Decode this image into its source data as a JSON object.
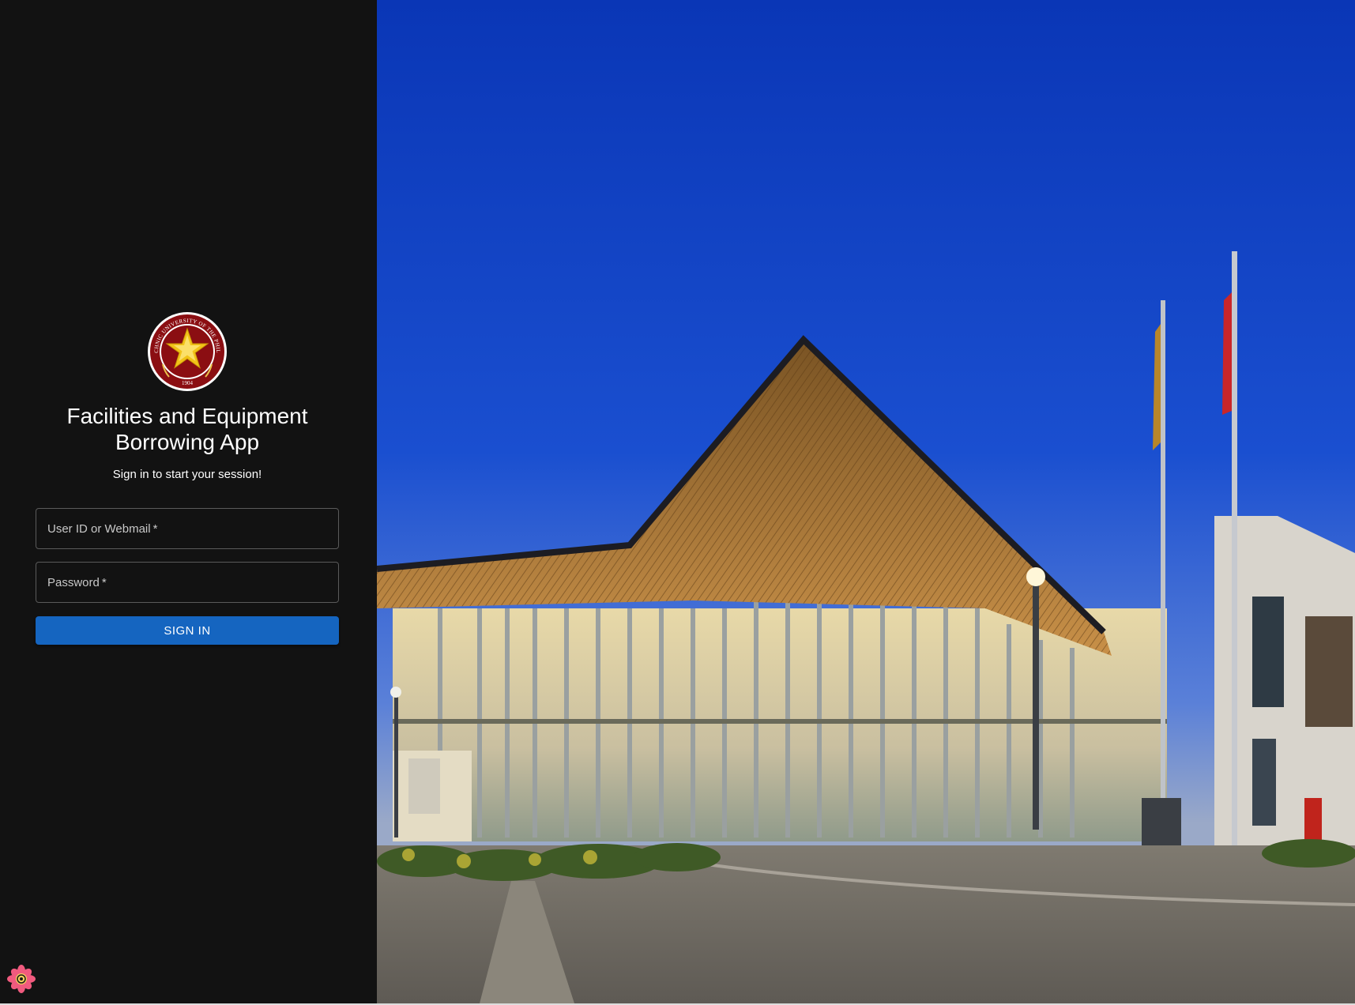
{
  "app": {
    "title": "Facilities and Equipment Borrowing App",
    "subtitle": "Sign in to start your session!"
  },
  "logo": {
    "name": "university-seal-logo",
    "seal_text": "POLYTECHNIC UNIVERSITY OF THE PHILIPPINES",
    "year": "1904"
  },
  "form": {
    "userid_label": "User ID or Webmail",
    "password_label": "Password",
    "required_mark": "*",
    "signin_label": "SIGN IN"
  },
  "colors": {
    "panel_bg": "#121212",
    "primary": "#1565c0",
    "seal_red": "#8b0e12",
    "seal_gold": "#f2c318"
  },
  "icons": {
    "devtools": "react-devtools-icon"
  },
  "background_image": "campus-building-at-dusk"
}
